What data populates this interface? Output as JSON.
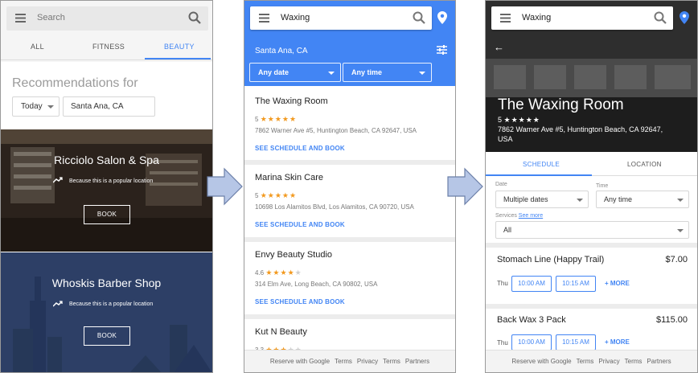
{
  "colors": {
    "accent": "#4285f4",
    "star": "#f2991e",
    "dark_card": "#2d3f66"
  },
  "screen1": {
    "search_placeholder": "Search",
    "tabs": [
      "ALL",
      "FITNESS",
      "BEAUTY"
    ],
    "active_tab": "BEAUTY",
    "recommendations_label": "Recommendations for",
    "when_value": "Today",
    "location_value": "Santa Ana, CA",
    "cards": [
      {
        "title": "Ricciolo Salon & Spa",
        "reason": "Because this is a popular location",
        "button": "BOOK"
      },
      {
        "title": "Whoskis Barber Shop",
        "reason": "Because this is a popular location",
        "button": "BOOK"
      }
    ]
  },
  "screen2": {
    "query": "Waxing",
    "location": "Santa Ana, CA",
    "date_filter": "Any date",
    "time_filter": "Any time",
    "results": [
      {
        "name": "The Waxing Room",
        "rating": "5",
        "stars": 5,
        "address": "7862 Warner Ave #5, Huntington Beach, CA 92647, USA",
        "link": "SEE SCHEDULE AND BOOK"
      },
      {
        "name": "Marina Skin Care",
        "rating": "5",
        "stars": 5,
        "address": "10698 Los Alamitos Blvd, Los Alamitos, CA 90720, USA",
        "link": "SEE SCHEDULE AND BOOK"
      },
      {
        "name": "Envy Beauty Studio",
        "rating": "4.6",
        "stars": 4.6,
        "address": "314 Elm Ave, Long Beach, CA 90802, USA",
        "link": "SEE SCHEDULE AND BOOK"
      },
      {
        "name": "Kut N Beauty",
        "rating": "3.3",
        "stars": 3.3
      }
    ],
    "footer": {
      "text": "Reserve with Google",
      "links": [
        "Terms",
        "Privacy",
        "Terms",
        "Partners"
      ]
    }
  },
  "screen3": {
    "query": "Waxing",
    "business_name": "The Waxing Room",
    "rating": "5",
    "stars": 5,
    "address": "7862 Warner Ave #5, Huntington Beach, CA 92647, USA",
    "tabs": [
      "SCHEDULE",
      "LOCATION"
    ],
    "active_tab": "SCHEDULE",
    "date_label": "Date",
    "date_value": "Multiple dates",
    "time_label": "Time",
    "time_value": "Any time",
    "services_label": "Services",
    "see_more": "See more",
    "services_value": "All",
    "services": [
      {
        "name": "Stomach Line (Happy Trail)",
        "price": "$7.00",
        "day": "Thu",
        "slots": [
          "10:00 AM",
          "10:15 AM"
        ],
        "more": "+ MORE"
      },
      {
        "name": "Back Wax 3 Pack",
        "price": "$115.00",
        "day": "Thu",
        "slots": [
          "10:00 AM",
          "10:15 AM"
        ],
        "more": "+ MORE"
      }
    ],
    "footer": {
      "text": "Reserve with Google",
      "links": [
        "Terms",
        "Privacy",
        "Terms",
        "Partners"
      ]
    }
  }
}
